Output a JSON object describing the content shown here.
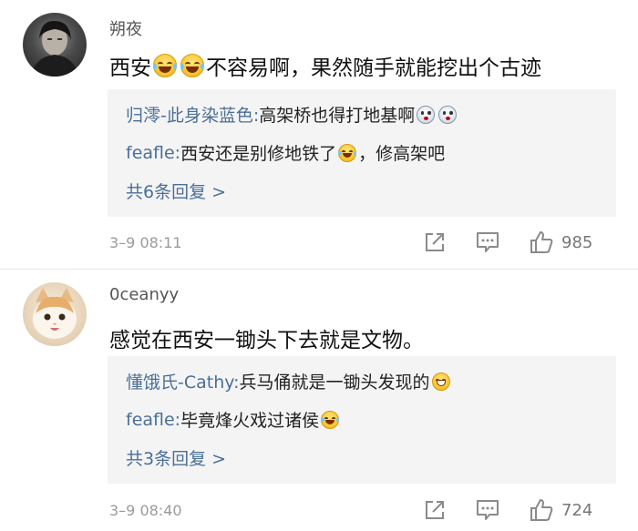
{
  "comments": [
    {
      "username": "朔夜",
      "text_a": "西安",
      "text_b": "不容易啊，果然随手就能挖出个古迹",
      "replies": [
        {
          "name": "归澪-此身染蓝色:",
          "text": " 高架桥也得打地基啊"
        },
        {
          "name": "feafle:",
          "text_a": " 西安还是别修地铁了",
          "text_b": "，修高架吧"
        }
      ],
      "more": "共6条回复 >",
      "time": "3–9 08:11",
      "likes": "985"
    },
    {
      "username": "0ceanyy",
      "text": "感觉在西安一锄头下去就是文物。",
      "replies": [
        {
          "name": "懂饿氏-Cathy:",
          "text": " 兵马俑就是一锄头发现的 "
        },
        {
          "name": "feafle:",
          "text": " 毕竟烽火戏过诸侯"
        }
      ],
      "more": "共3条回复 >",
      "time": "3–9 08:40",
      "likes": "724"
    }
  ],
  "icons": {
    "share": "share-icon",
    "comment": "comment-icon",
    "like": "thumbs-up-icon"
  },
  "colors": {
    "link": "#4a6f98",
    "meta": "#9a9a9a",
    "reply_bg": "#f4f4f4"
  }
}
